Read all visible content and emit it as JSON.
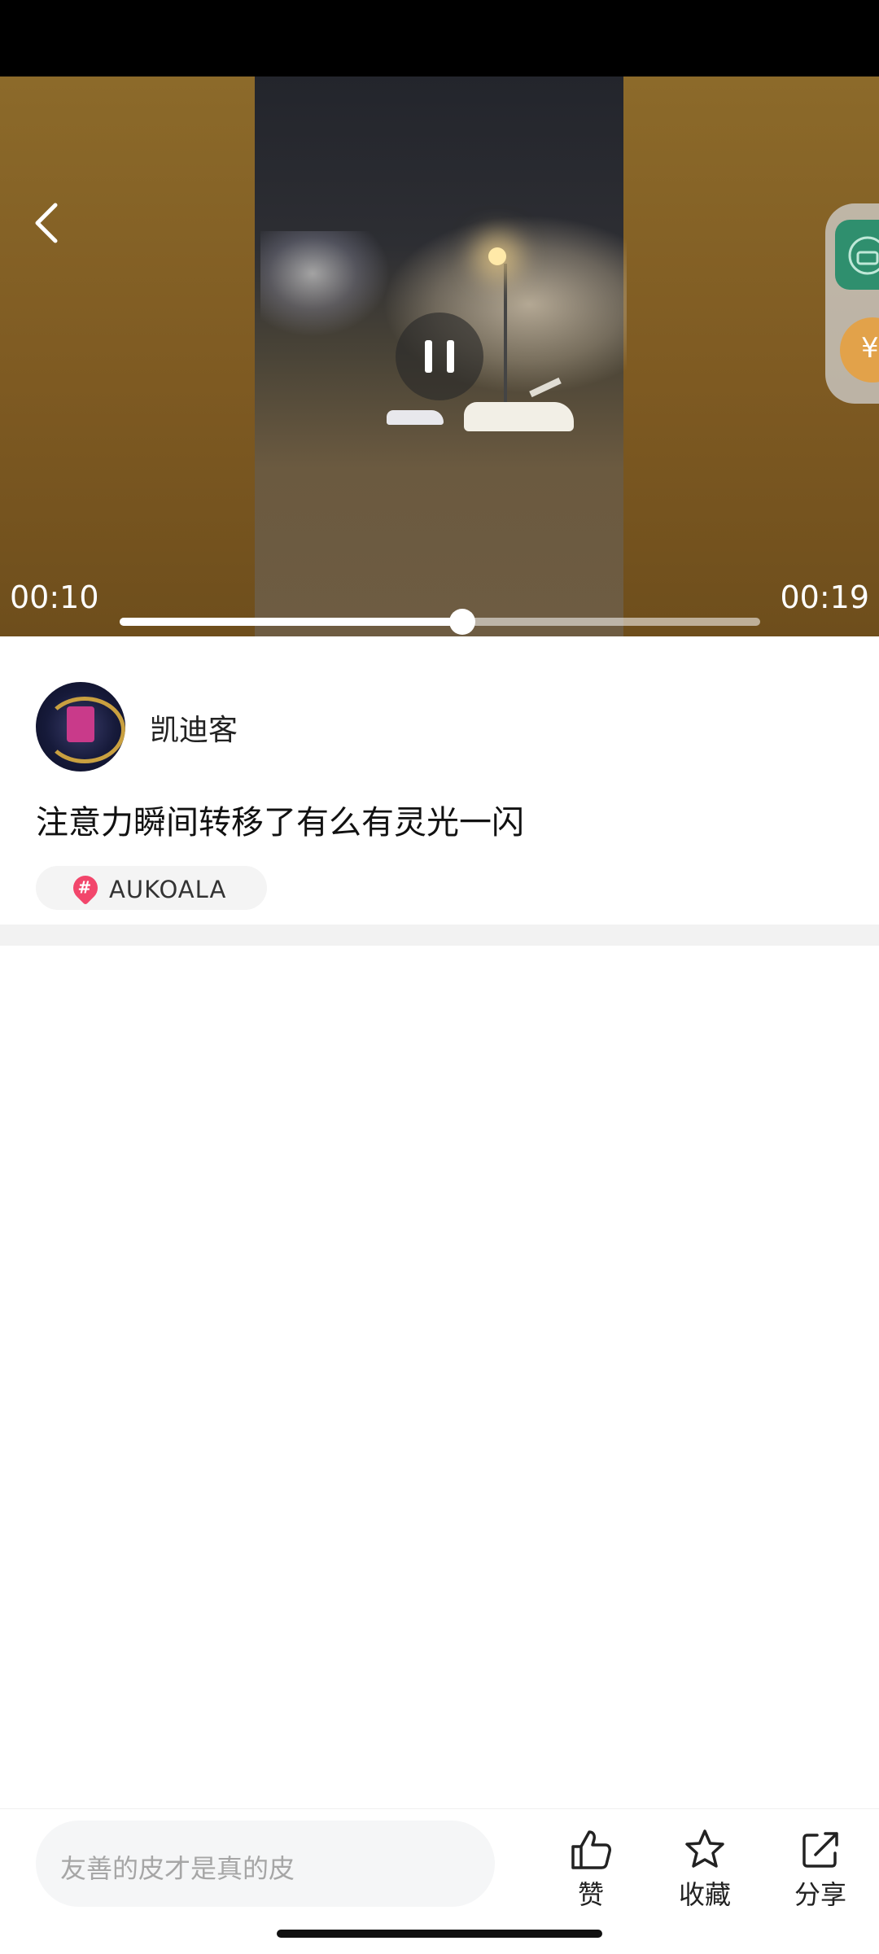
{
  "player": {
    "current_time": "00:10",
    "total_time": "00:19",
    "progress": 0.535,
    "state": "playing"
  },
  "post": {
    "author_name": "凯迪客",
    "caption": "注意力瞬间转移了有么有灵光一闪",
    "tag": "AUKOALA"
  },
  "bottom_bar": {
    "comment_placeholder": "友善的皮才是真的皮",
    "like_label": "赞",
    "favorite_label": "收藏",
    "share_label": "分享"
  },
  "colors": {
    "tag_icon": "#f2466b",
    "side_app_icon": "#2f8f6e",
    "side_coin_icon": "#e2a24a"
  },
  "icons": [
    "back-chevron-icon",
    "pause-icon",
    "hashtag-icon",
    "thumbs-up-icon",
    "star-icon",
    "share-icon"
  ]
}
